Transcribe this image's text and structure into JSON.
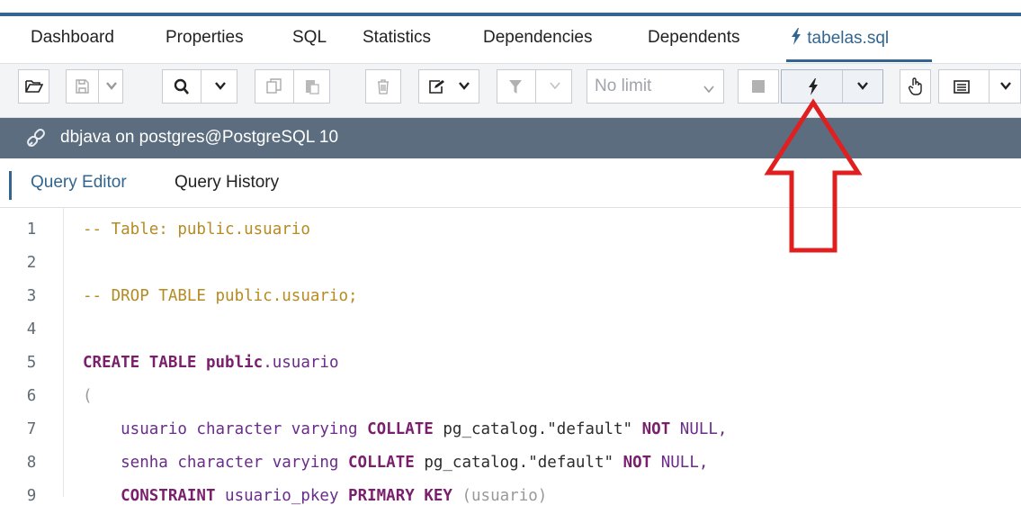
{
  "tabs": {
    "dashboard": "Dashboard",
    "properties": "Properties",
    "sql": "SQL",
    "statistics": "Statistics",
    "dependencies": "Dependencies",
    "dependents": "Dependents",
    "active_file": "tabelas.sql"
  },
  "toolbar": {
    "limit_select": "No limit",
    "icons": [
      "folder-open-icon",
      "save-icon",
      "chevron-down-icon",
      "search-icon",
      "chevron-down-icon",
      "copy-icon",
      "paste-icon",
      "trash-icon",
      "edit-icon",
      "chevron-down-icon",
      "filter-icon",
      "chevron-down-icon",
      "stop-icon",
      "lightning-icon",
      "chevron-down-icon",
      "pointer-icon",
      "list-icon",
      "chevron-down-icon"
    ]
  },
  "connection": {
    "label": "dbjava on postgres@PostgreSQL 10"
  },
  "editor_tabs": {
    "query_editor": "Query Editor",
    "query_history": "Query History"
  },
  "code": {
    "line_numbers": [
      "1",
      "2",
      "3",
      "4",
      "5",
      "6",
      "7",
      "8",
      "9"
    ],
    "l1": "-- Table: public.usuario",
    "l3": "-- DROP TABLE public.usuario;",
    "l5_kw1": "CREATE TABLE",
    "l5_kw2": "public",
    "l5_rest": ".usuario",
    "l6": "(",
    "l7_a": "    usuario character varying ",
    "l7_kw": "COLLATE",
    "l7_b": " pg_catalog.\"default\" ",
    "l7_kw2": "NOT",
    "l7_c": " NULL,",
    "l8_a": "    senha character varying ",
    "l8_kw": "COLLATE",
    "l8_b": " pg_catalog.\"default\" ",
    "l8_kw2": "NOT",
    "l8_c": " NULL,",
    "l9_kw": "    CONSTRAINT",
    "l9_a": " usuario_pkey ",
    "l9_kw2": "PRIMARY KEY",
    "l9_b": " (usuario)"
  },
  "colors": {
    "accent": "#326690",
    "connbar": "#5b6d7e",
    "arrow": "#e02020"
  }
}
